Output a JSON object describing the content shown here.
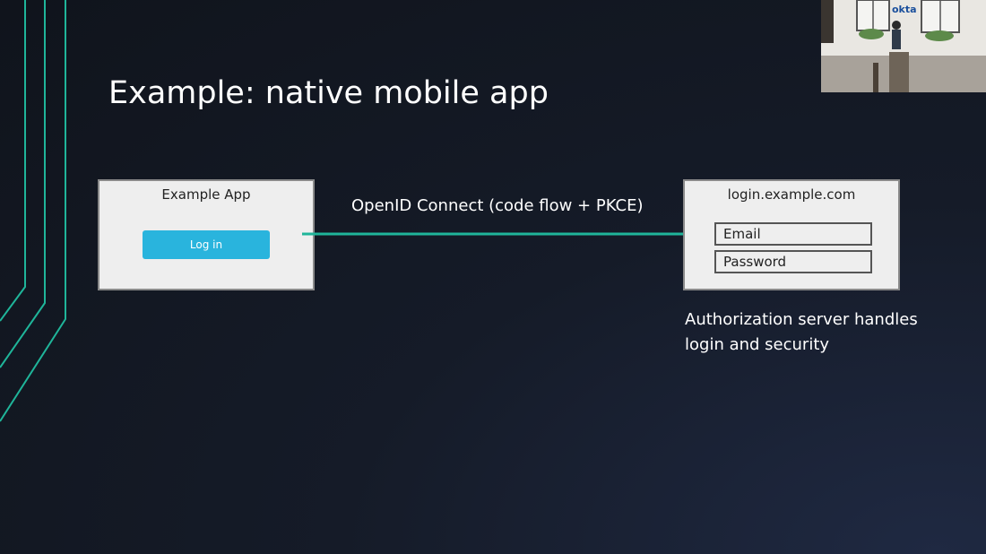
{
  "slide": {
    "title": "Example: native mobile app"
  },
  "left_box": {
    "title": "Example App",
    "button_label": "Log in"
  },
  "connection": {
    "label": "OpenID Connect (code flow + PKCE)"
  },
  "right_box": {
    "title": "login.example.com",
    "email_label": "Email",
    "password_label": "Password"
  },
  "caption": {
    "line1": "Authorization server handles",
    "line2": "login and security"
  },
  "webcam": {
    "logo_text": "okta"
  },
  "colors": {
    "accent": "#1fb59a",
    "button": "#29b4dd",
    "box_bg": "#eeeeee"
  }
}
